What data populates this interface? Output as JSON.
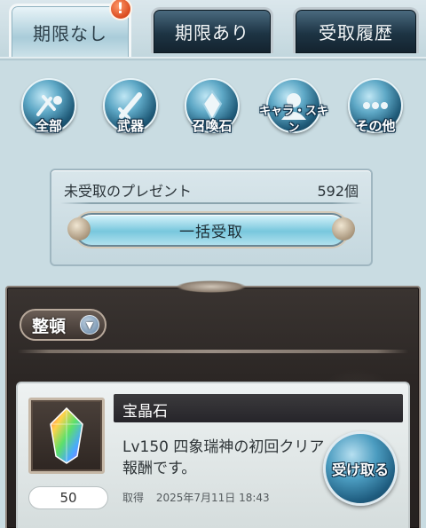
{
  "tabs": [
    {
      "label": "期限なし",
      "active": true,
      "alert": "!"
    },
    {
      "label": "期限あり",
      "active": false
    },
    {
      "label": "受取履歴",
      "active": false
    }
  ],
  "categories": [
    {
      "label": "全部",
      "icon": "all-items-icon"
    },
    {
      "label": "武器",
      "icon": "weapon-icon"
    },
    {
      "label": "召喚石",
      "icon": "summon-stone-icon"
    },
    {
      "label": "キャラ・スキン",
      "icon": "character-skin-icon"
    },
    {
      "label": "その他",
      "icon": "more-icon"
    }
  ],
  "present": {
    "label": "未受取のプレゼント",
    "count": "592個",
    "bulk_button": "一括受取"
  },
  "sort": {
    "label": "整頓"
  },
  "items": [
    {
      "name": "宝晶石",
      "description": "Lv150 四象瑞神の初回クリア報酬です。",
      "quantity": "50",
      "acquired_label": "取得",
      "acquired_date": "2025年7月11日 18:43",
      "receive_button": "受け取る",
      "icon": "crystal-icon"
    }
  ],
  "colors": {
    "accent": "#4b9cc0",
    "tab_dark": "#1d3444",
    "panel_dark": "#2b2624"
  }
}
